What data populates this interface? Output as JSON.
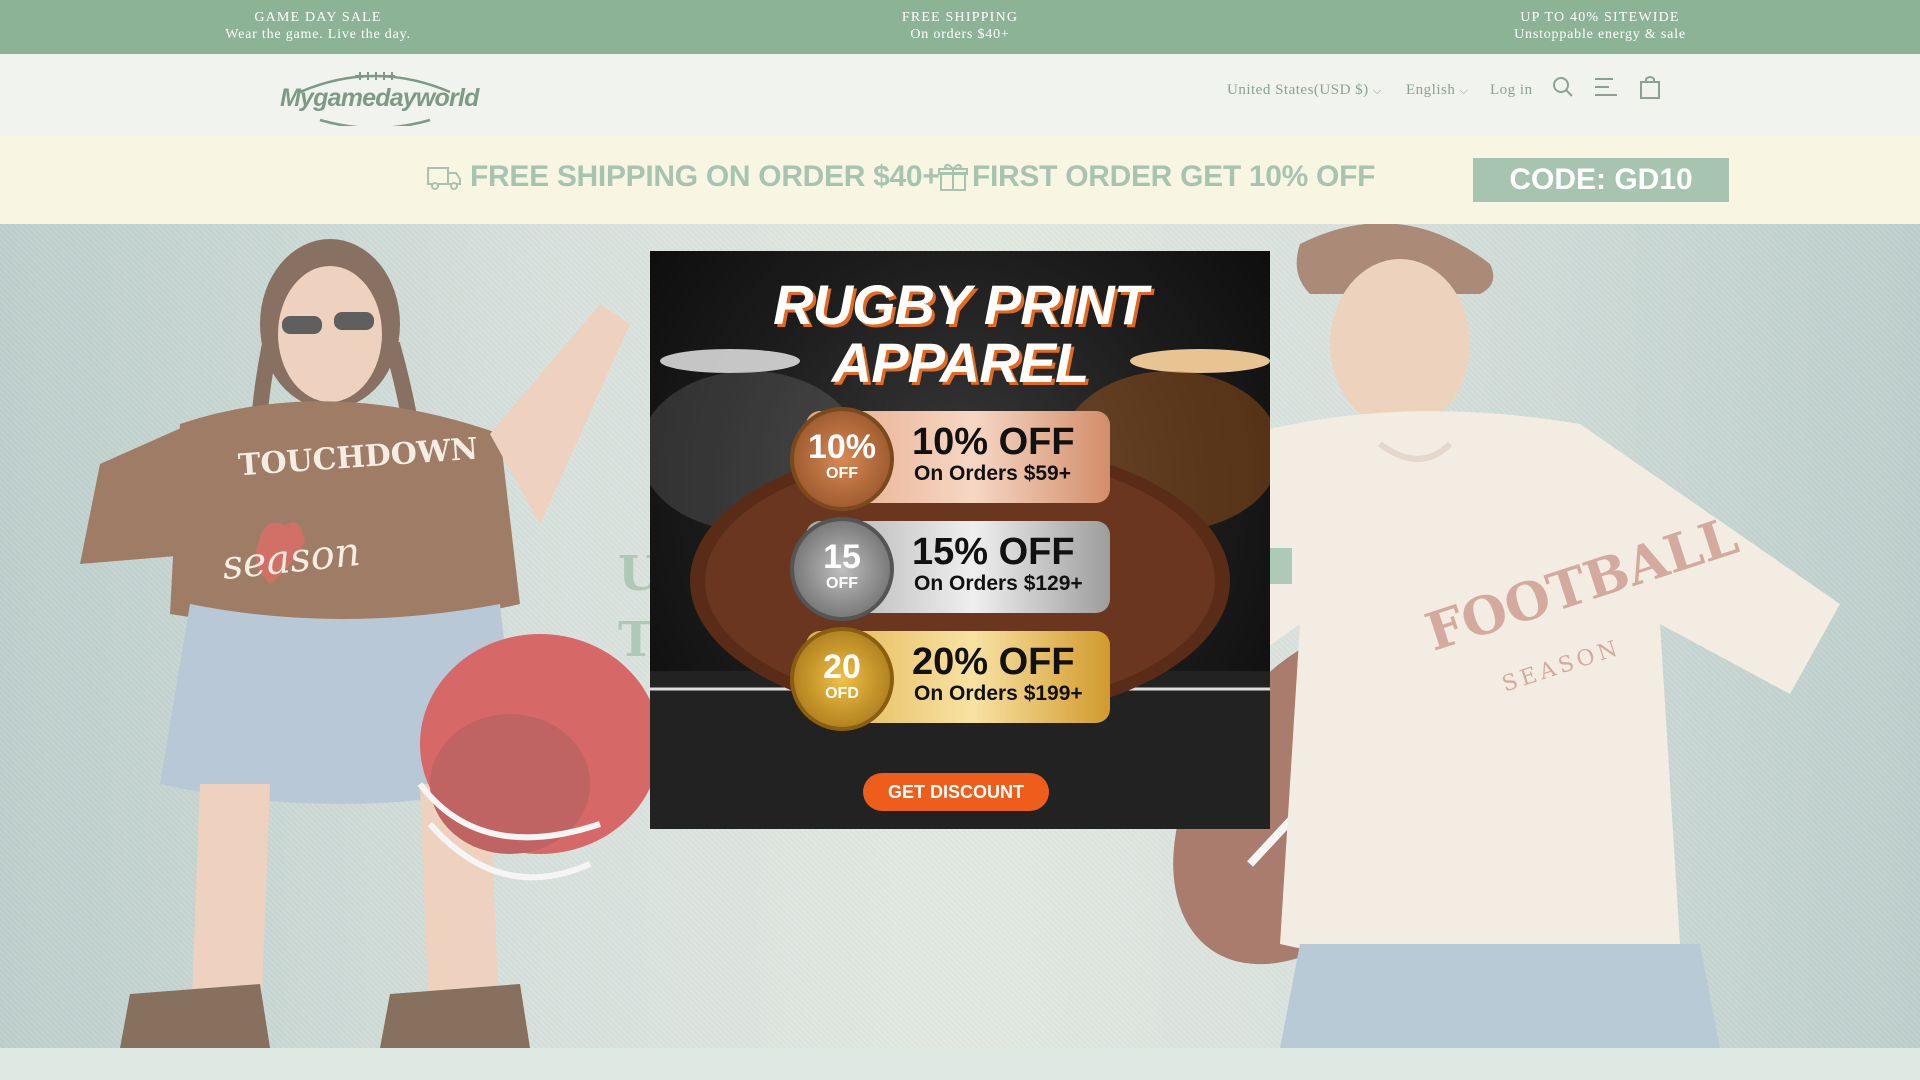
{
  "announcement": {
    "items": [
      {
        "title": "GAME DAY SALE",
        "subtitle": "Wear the game. Live the day."
      },
      {
        "title": "FREE SHIPPING",
        "subtitle": "On orders $40+"
      },
      {
        "title": "UP TO 40% SITEWIDE",
        "subtitle": "Unstoppable energy & sale"
      }
    ],
    "color": "#8db396"
  },
  "header": {
    "logo_text": "Mygamedayworld",
    "country": "United States(USD $)",
    "language": "English",
    "login": "Log in",
    "icons": [
      "search-icon",
      "menu-icon",
      "cart-icon"
    ]
  },
  "promo": {
    "shipping": "FREE SHIPPING ON ORDER $40+",
    "first_order": "FIRST ORDER GET 10% OFF",
    "code": "CODE: GD10",
    "accent": "#86ad92"
  },
  "hero": {
    "partial_text_1": "U",
    "partial_text_2": "T",
    "shirt_left": [
      "TOUCHDOWN",
      "season"
    ],
    "shirt_right": [
      "FOOTBALL",
      "SEASON"
    ]
  },
  "popup": {
    "title_line1": "RUGBY PRINT",
    "title_line2": "APPAREL",
    "tiers": [
      {
        "medal": "10%",
        "medal_sub": "OFF",
        "headline": "10% OFF",
        "condition": "On Orders $59+"
      },
      {
        "medal": "15",
        "medal_sub": "OFF",
        "headline": "15% OFF",
        "condition": "On Orders $129+"
      },
      {
        "medal": "20",
        "medal_sub": "OFD",
        "headline": "20% OFF",
        "condition": "On Orders $199+"
      }
    ],
    "button": "GET DISCOUNT",
    "button_color": "#ee5d19"
  }
}
